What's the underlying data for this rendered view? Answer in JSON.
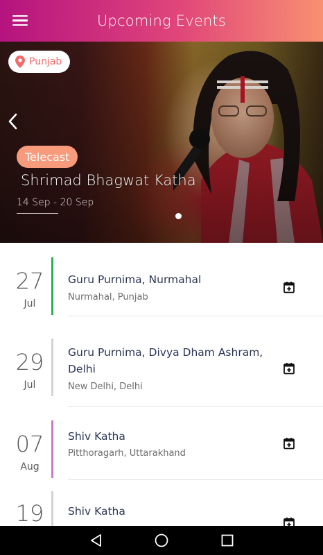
{
  "app_bar": {
    "title": "Upcoming Events",
    "background_gradient": [
      "#b5137f",
      "#e0457a",
      "#f99071"
    ]
  },
  "featured": {
    "location": "Punjab",
    "tag": "Telecast",
    "title": "Shrimad Bhagwat Katha",
    "dates": "14 Sep - 20 Sep",
    "carousel_dots": 1,
    "active_dot": 0
  },
  "events": [
    {
      "day": "27",
      "month": "Jul",
      "name": "Guru Purnima, Nurmahal",
      "place": "Nurmahal, Punjab",
      "accent": "#22b14c"
    },
    {
      "day": "29",
      "month": "Jul",
      "name": "Guru Purnima, Divya Dham Ashram, Delhi",
      "place": "New Delhi, Delhi",
      "accent": "#d3d3d3"
    },
    {
      "day": "07",
      "month": "Aug",
      "name": "Shiv Katha",
      "place": "Pitthoragarh, Uttarakhand",
      "accent": "#cc77cc"
    },
    {
      "day": "19",
      "month": "",
      "name": "Shiv Katha",
      "place": "",
      "accent": "#d3d3d3"
    }
  ],
  "icons": {
    "menu": "menu-icon",
    "location": "location-pin-icon",
    "prev": "chevron-left-icon",
    "add_calendar": "calendar-add-icon",
    "nav_back": "triangle-back-icon",
    "nav_home": "circle-home-icon",
    "nav_recents": "square-recents-icon"
  }
}
